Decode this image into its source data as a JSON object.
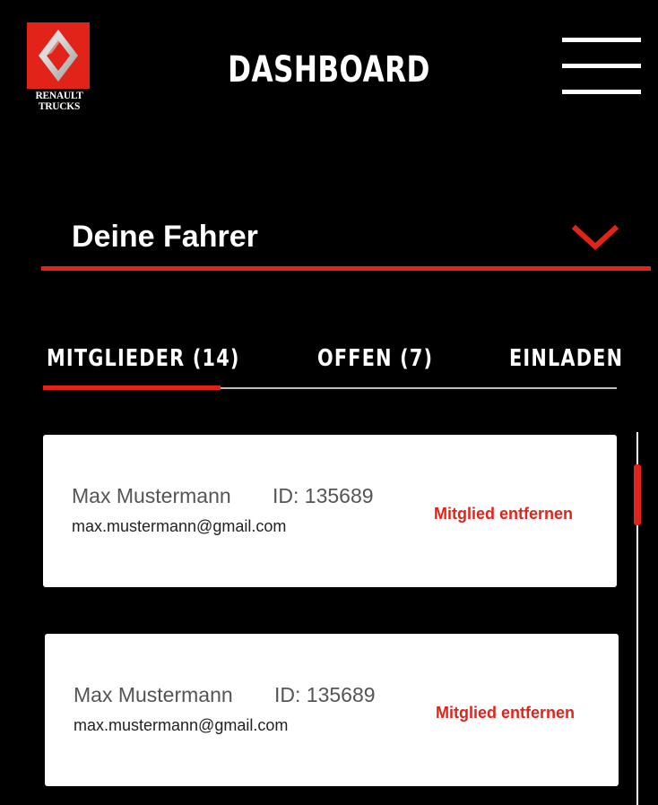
{
  "brand": {
    "logo_line1": "RENAULT",
    "logo_line2": "TRUCKS",
    "accent_color": "#e2231a"
  },
  "header": {
    "title": "DASHBOARD",
    "menu_icon": "hamburger-icon"
  },
  "selector": {
    "label": "Deine Fahrer",
    "icon": "chevron-down-icon"
  },
  "tabs": [
    {
      "label": "MITGLIEDER (14)",
      "active": true
    },
    {
      "label": "OFFEN (7)",
      "active": false
    },
    {
      "label": "EINLADEN",
      "active": false
    }
  ],
  "members": [
    {
      "name": "Max Mustermann",
      "id": "ID: 135689",
      "email": "max.mustermann@gmail.com",
      "action": "Mitglied entfernen"
    },
    {
      "name": "Max Mustermann",
      "id": "ID: 135689",
      "email": "max.mustermann@gmail.com",
      "action": "Mitglied entfernen"
    }
  ]
}
